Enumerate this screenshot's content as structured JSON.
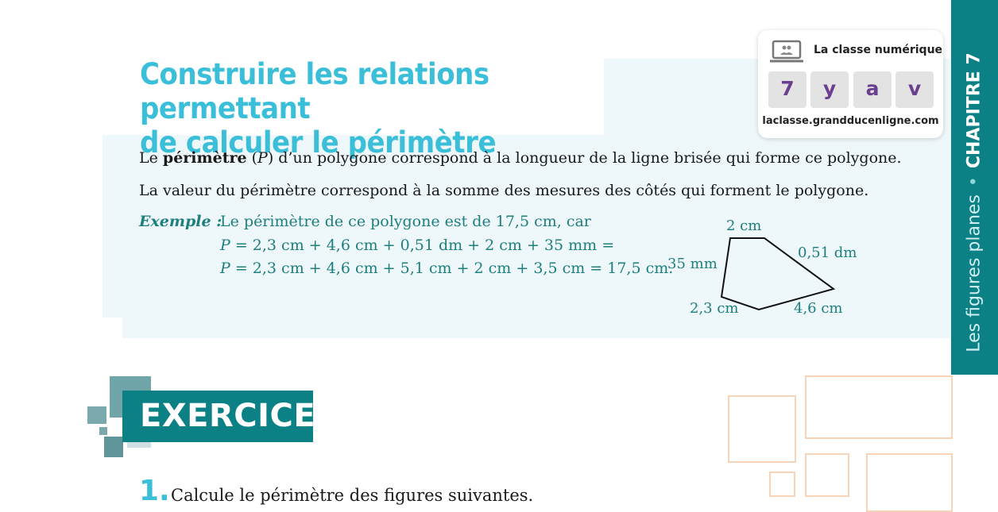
{
  "title": {
    "line1": "Construire les relations permettant",
    "line2": "de calculer le périmètre"
  },
  "paragraphs": {
    "p1_before": "Le ",
    "p1_bold": "périmètre",
    "p1_mid": " (",
    "p1_italic": "P",
    "p1_after": ") d’un polygone correspond à la longueur de la ligne brisée qui forme ce polygone.",
    "p2": "La valeur du périmètre correspond à la somme des mesures des côtés qui forment le polygone."
  },
  "example": {
    "label": "Exemple :",
    "line1": "Le périmètre de ce polygone est de 17,5 cm, car",
    "line2_var": "P",
    "line2_rest": " = 2,3 cm + 4,6 cm + 0,51 dm + 2 cm + 35 mm =",
    "line3_var": "P",
    "line3_rest": " = 2,3 cm + 4,6 cm + 5,1 cm + 2 cm + 3,5 cm = 17,5 cm."
  },
  "polygon": {
    "labels": {
      "top": "2 cm",
      "right": "0,51 dm",
      "left": "35 mm",
      "bottom_left": "2,3 cm",
      "bottom_right": "4,6 cm"
    }
  },
  "classe_numerique": {
    "title": "La classe numérique",
    "code": [
      "7",
      "y",
      "a",
      "v"
    ],
    "url": "laclasse.grandducenligne.com",
    "icon": "laptop-icon"
  },
  "chapter_tab": {
    "chapter": "CHAPITRE 7",
    "separator": "•",
    "theme": "Les figures planes"
  },
  "exercises": {
    "banner": "EXERCICES",
    "items": [
      {
        "number": "1.",
        "text": "Calcule le périmètre des figures suivantes."
      }
    ]
  },
  "colors": {
    "teal": "#0b8185",
    "title_cyan": "#3bbfd9",
    "example_teal": "#1d7f7e",
    "panel_bg": "#eef7fa",
    "code_purple": "#6a3f8f",
    "deco_peach": "#f7d3b8"
  }
}
